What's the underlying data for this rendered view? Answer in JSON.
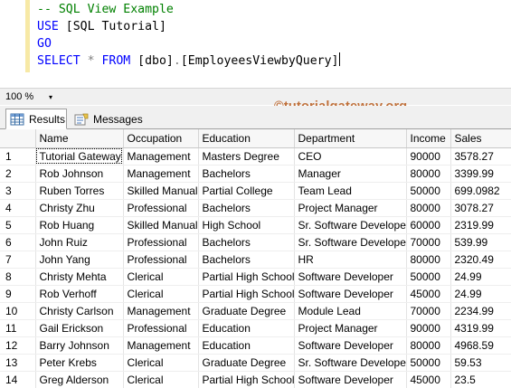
{
  "editor": {
    "lines": [
      {
        "comment": "-- SQL View Example"
      },
      {
        "kw": "USE",
        "rest": " [SQL Tutorial]"
      },
      {
        "kw": "GO"
      },
      {
        "kw1": "SELECT",
        "op": " * ",
        "kw2": "FROM",
        "rest1": " [dbo]",
        "dot": ".",
        "rest2": "[EmployeesViewbyQuery]"
      }
    ]
  },
  "zoom": {
    "value": "100 %",
    "arrow": "▾"
  },
  "watermark": "©tutorialgateway.org",
  "tabs": {
    "results": "Results",
    "messages": "Messages"
  },
  "grid": {
    "columns": [
      "Name",
      "Occupation",
      "Education",
      "Department",
      "Income",
      "Sales"
    ],
    "rows": [
      [
        "1",
        "Tutorial Gateway",
        "Management",
        "Masters Degree",
        "CEO",
        "90000",
        "3578.27"
      ],
      [
        "2",
        "Rob Johnson",
        "Management",
        "Bachelors",
        "Manager",
        "80000",
        "3399.99"
      ],
      [
        "3",
        "Ruben Torres",
        "Skilled Manual",
        "Partial College",
        "Team Lead",
        "50000",
        "699.0982"
      ],
      [
        "4",
        "Christy Zhu",
        "Professional",
        "Bachelors",
        "Project Manager",
        "80000",
        "3078.27"
      ],
      [
        "5",
        "Rob Huang",
        "Skilled Manual",
        "High School",
        "Sr. Software Developer",
        "60000",
        "2319.99"
      ],
      [
        "6",
        "John Ruiz",
        "Professional",
        "Bachelors",
        "Sr. Software Developer",
        "70000",
        "539.99"
      ],
      [
        "7",
        "John Yang",
        "Professional",
        "Bachelors",
        "HR",
        "80000",
        "2320.49"
      ],
      [
        "8",
        "Christy Mehta",
        "Clerical",
        "Partial High School",
        "Software Developer",
        "50000",
        "24.99"
      ],
      [
        "9",
        "Rob Verhoff",
        "Clerical",
        "Partial High School",
        "Software Developer",
        "45000",
        "24.99"
      ],
      [
        "10",
        "Christy Carlson",
        "Management",
        "Graduate Degree",
        "Module Lead",
        "70000",
        "2234.99"
      ],
      [
        "11",
        "Gail Erickson",
        "Professional",
        "Education",
        "Project Manager",
        "90000",
        "4319.99"
      ],
      [
        "12",
        "Barry Johnson",
        "Management",
        "Education",
        "Software Developer",
        "80000",
        "4968.59"
      ],
      [
        "13",
        "Peter Krebs",
        "Clerical",
        "Graduate Degree",
        "Sr. Software Developer",
        "50000",
        "59.53"
      ],
      [
        "14",
        "Greg Alderson",
        "Clerical",
        "Partial High School",
        "Software Developer",
        "45000",
        "23.5"
      ]
    ]
  },
  "colors": {
    "keyword": "#0000ff",
    "comment": "#008000",
    "watermark": "#c0703a"
  },
  "icons": {
    "results": "grid-icon",
    "messages": "messages-icon"
  }
}
